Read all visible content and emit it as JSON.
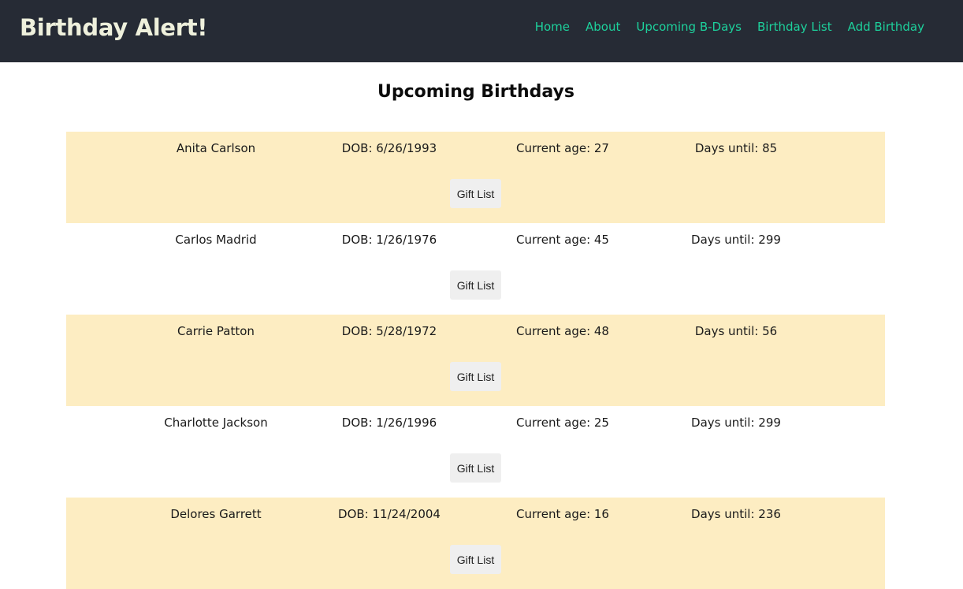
{
  "navbar": {
    "brand": "Birthday Alert!",
    "links": [
      "Home",
      "About",
      "Upcoming B-Days",
      "Birthday List",
      "Add Birthday"
    ]
  },
  "main": {
    "title": "Upcoming Birthdays",
    "rows": [
      {
        "name": "Anita Carlson",
        "dob": "DOB: 6/26/1993",
        "age": "Current age: 27",
        "days": "Days until: 85",
        "button": "Gift List"
      },
      {
        "name": "Carlos Madrid",
        "dob": "DOB: 1/26/1976",
        "age": "Current age: 45",
        "days": "Days until: 299",
        "button": "Gift List"
      },
      {
        "name": "Carrie Patton",
        "dob": "DOB: 5/28/1972",
        "age": "Current age: 48",
        "days": "Days until: 56",
        "button": "Gift List"
      },
      {
        "name": "Charlotte Jackson",
        "dob": "DOB: 1/26/1996",
        "age": "Current age: 25",
        "days": "Days until: 299",
        "button": "Gift List"
      },
      {
        "name": "Delores Garrett",
        "dob": "DOB: 11/24/2004",
        "age": "Current age: 16",
        "days": "Days until: 236",
        "button": "Gift List"
      }
    ]
  },
  "colors": {
    "navbar_bg": "#262b35",
    "brand_text": "#eef0dc",
    "nav_link": "#1dd19c",
    "row_highlight": "#fdedc2",
    "button_bg": "#efefef"
  }
}
